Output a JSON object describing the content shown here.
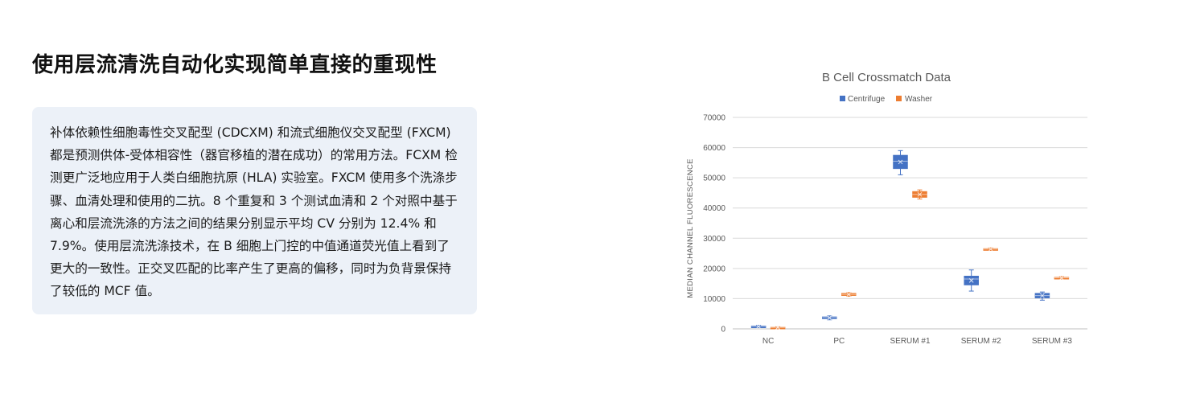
{
  "heading": "使用层流清洗自动化实现简单直接的重现性",
  "body_text": "补体依赖性细胞毒性交叉配型 (CDCXM) 和流式细胞仪交叉配型 (FXCM) 都是预测供体-受体相容性（器官移植的潜在成功）的常用方法。FCXM 检测更广泛地应用于人类白细胞抗原 (HLA) 实验室。FXCM 使用多个洗涤步骤、血清处理和使用的二抗。8 个重复和 3 个测试血清和 2 个对照中基于离心和层流洗涤的方法之间的结果分别显示平均 CV 分别为 12.4% 和 7.9%。使用层流洗涤技术，在 B 细胞上门控的中值通道荧光值上看到了更大的一致性。正交叉匹配的比率产生了更高的偏移，同时为负背景保持了较低的 MCF 值。",
  "colors": {
    "centrifuge": "#4472c4",
    "washer": "#ed7d31"
  },
  "chart_data": {
    "type": "box",
    "title": "B Cell Crossmatch Data",
    "xlabel": "",
    "ylabel": "MEDIAN CHANNEL FLUORESCENCE",
    "ylim": [
      0,
      70000
    ],
    "yticks": [
      "0",
      "10000",
      "20000",
      "30000",
      "40000",
      "50000",
      "60000",
      "70000"
    ],
    "yticks_values": [
      0,
      10000,
      20000,
      30000,
      40000,
      50000,
      60000,
      70000
    ],
    "grid": true,
    "legend": "top",
    "categories": [
      "NC",
      "PC",
      "SERUM #1",
      "SERUM #2",
      "SERUM #3"
    ],
    "series": [
      {
        "name": "Centrifuge",
        "boxes": [
          {
            "min": 500,
            "q1": 600,
            "median": 800,
            "q3": 1000,
            "max": 1200
          },
          {
            "min": 3000,
            "q1": 3300,
            "median": 3700,
            "q3": 4000,
            "max": 4300
          },
          {
            "min": 51000,
            "q1": 53000,
            "median": 55500,
            "q3": 57500,
            "max": 59000
          },
          {
            "min": 12500,
            "q1": 14500,
            "median": 16500,
            "q3": 17500,
            "max": 19500
          },
          {
            "min": 9500,
            "q1": 10200,
            "median": 11000,
            "q3": 11800,
            "max": 12200
          }
        ]
      },
      {
        "name": "Washer",
        "boxes": [
          {
            "min": 300,
            "q1": 400,
            "median": 500,
            "q3": 600,
            "max": 700
          },
          {
            "min": 10800,
            "q1": 11000,
            "median": 11400,
            "q3": 11800,
            "max": 12000
          },
          {
            "min": 43000,
            "q1": 43500,
            "median": 44500,
            "q3": 45500,
            "max": 46000
          },
          {
            "min": 26000,
            "q1": 26200,
            "median": 26400,
            "q3": 26600,
            "max": 26800
          },
          {
            "min": 16500,
            "q1": 16600,
            "median": 16900,
            "q3": 17100,
            "max": 17300
          }
        ]
      }
    ]
  }
}
